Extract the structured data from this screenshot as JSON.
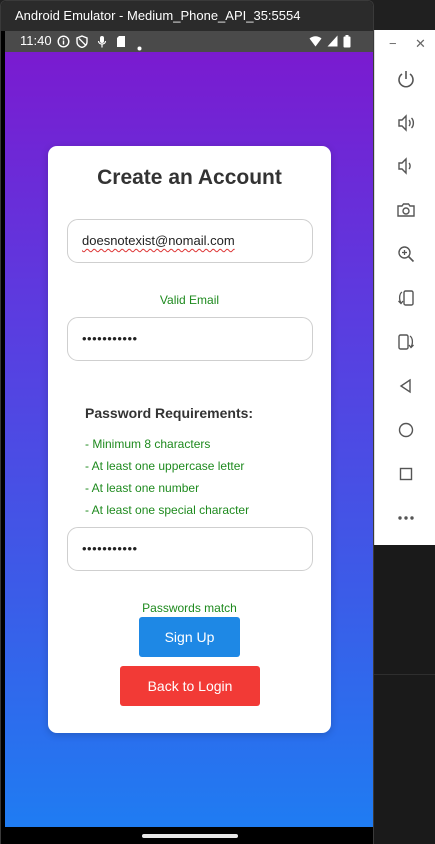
{
  "window": {
    "title": "Android Emulator - Medium_Phone_API_35:5554"
  },
  "statusbar": {
    "time": "11:40",
    "left_icons": [
      "info-icon",
      "shield-icon",
      "mic-icon",
      "sdcard-icon",
      "dot-icon"
    ],
    "right_icons": [
      "wifi-icon",
      "signal-icon",
      "battery-icon"
    ]
  },
  "form": {
    "title": "Create an Account",
    "email_value": "doesnotexist@nomail.com",
    "email_status": "Valid Email",
    "password_value": "•••••••••••",
    "requirements_title": "Password Requirements:",
    "requirements": [
      "- Minimum 8 characters",
      "- At least one uppercase letter",
      "- At least one number",
      "- At least one special character"
    ],
    "confirm_value": "•••••••••••",
    "match_status": "Passwords match",
    "signup_label": "Sign Up",
    "back_label": "Back to Login"
  },
  "colors": {
    "gradient_top": "#7a1bd0",
    "gradient_bottom": "#1f7cf2",
    "valid_green": "#1e8a1e",
    "signup_blue": "#1e88e5",
    "back_red": "#f23a36"
  },
  "side_panel": {
    "controls": [
      "minimize-icon",
      "close-icon"
    ],
    "buttons": [
      "power-icon",
      "volume-up-icon",
      "volume-down-icon",
      "camera-icon",
      "zoom-icon",
      "rotate-left-icon",
      "rotate-right-icon",
      "back-icon",
      "home-icon",
      "overview-icon",
      "more-icon"
    ],
    "minimize_glyph": "−",
    "close_glyph": "✕"
  }
}
